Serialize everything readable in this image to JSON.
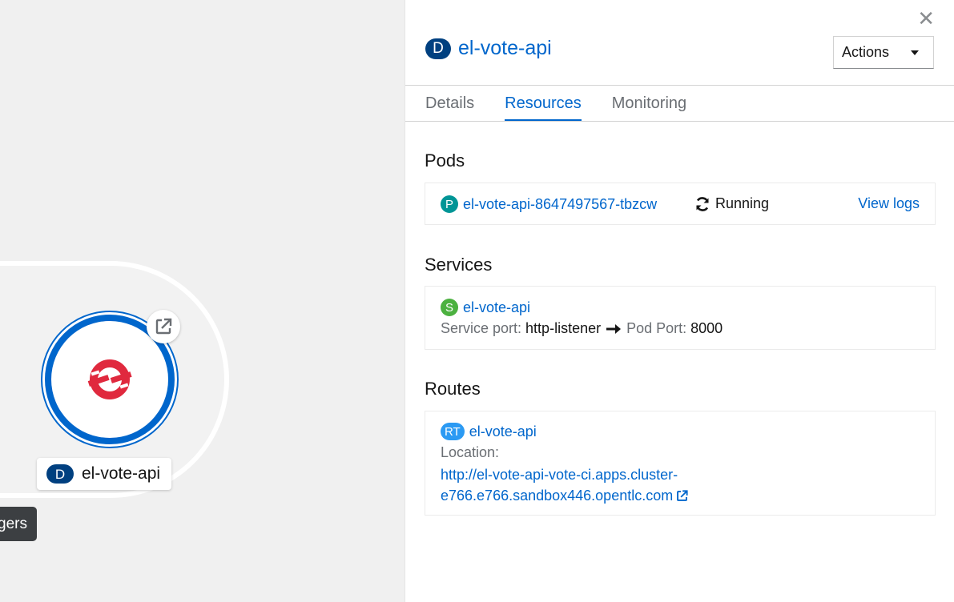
{
  "topology": {
    "node_badge": "D",
    "node_label": "el-vote-api",
    "tooltip_text": "gers"
  },
  "panel": {
    "title_badge": "D",
    "title": "el-vote-api",
    "actions_label": "Actions",
    "tabs": [
      {
        "label": "Details",
        "active": false
      },
      {
        "label": "Resources",
        "active": true
      },
      {
        "label": "Monitoring",
        "active": false
      }
    ],
    "pods": {
      "heading": "Pods",
      "items": [
        {
          "badge": "P",
          "name": "el-vote-api-8647497567-tbzcw",
          "status": "Running",
          "logs_link": "View logs"
        }
      ]
    },
    "services": {
      "heading": "Services",
      "items": [
        {
          "badge": "S",
          "name": "el-vote-api",
          "service_port_label": "Service port:",
          "service_port": "http-listener",
          "pod_port_label": "Pod Port:",
          "pod_port": "8000"
        }
      ]
    },
    "routes": {
      "heading": "Routes",
      "items": [
        {
          "badge": "RT",
          "name": "el-vote-api",
          "location_label": "Location:",
          "location_line1": "http://el-vote-api-vote-ci.apps.cluster-",
          "location_line2": "e766.e766.sandbox446.opentlc.com"
        }
      ]
    }
  },
  "colors": {
    "link": "#0066cc",
    "deployment_badge": "#004080",
    "pod_badge": "#009596",
    "service_badge": "#4cb140",
    "route_badge": "#2b9af3",
    "node_ring": "#0066cc",
    "openshift_red": "#e0293e"
  },
  "icons": {
    "close": "close-icon",
    "caret": "caret-down-icon",
    "sync": "sync-icon",
    "arrow": "long-arrow-right-icon",
    "external": "external-link-icon",
    "node_logo": "openshift-logo"
  }
}
